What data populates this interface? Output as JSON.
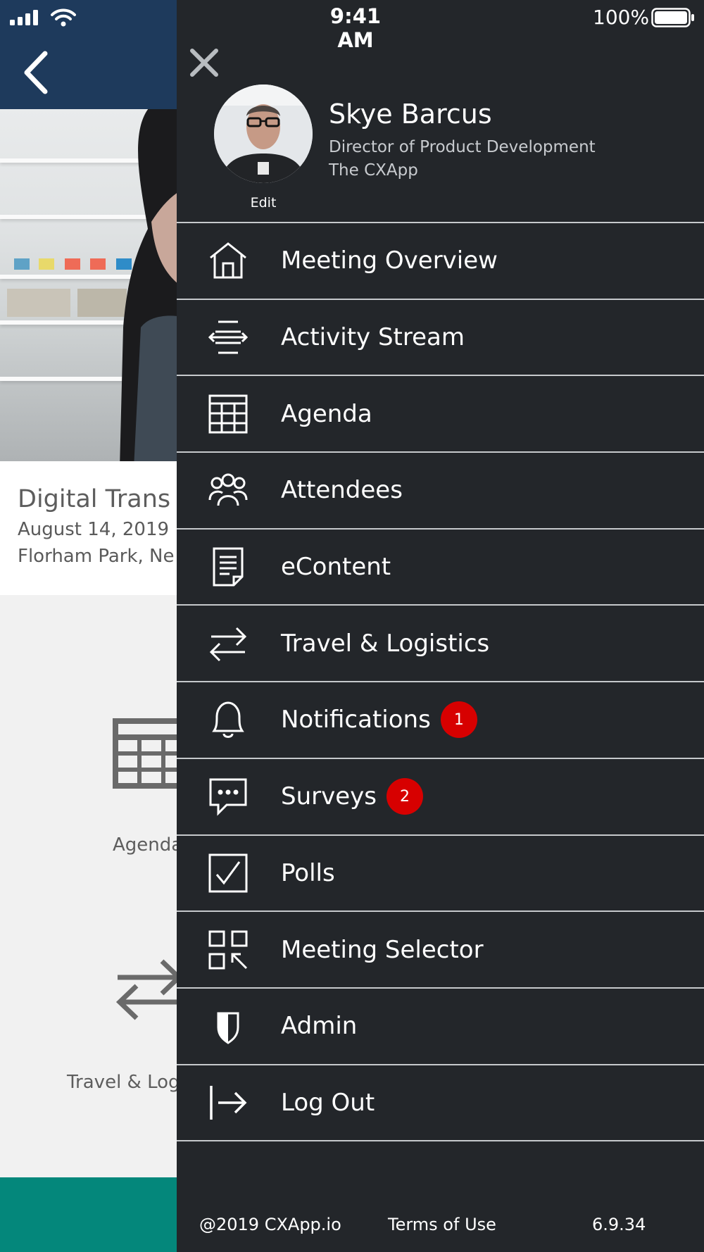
{
  "status_bar": {
    "time": "9:41 AM",
    "battery_percent": "100%",
    "signal_icon": "cellular-signal-icon",
    "wifi_icon": "wifi-icon",
    "battery_icon": "battery-full-icon"
  },
  "background_page": {
    "back_icon": "chevron-left-icon",
    "event": {
      "title": "Digital Trans",
      "date": "August 14, 2019",
      "location": "Florham Park, Ne"
    },
    "tiles": [
      {
        "label": "Agenda",
        "icon": "grid-table-icon"
      },
      {
        "label": "Travel & Log",
        "icon": "swap-arrows-icon"
      }
    ]
  },
  "drawer": {
    "close_icon": "close-icon",
    "profile": {
      "name": "Skye Barcus",
      "title": "Director of Product Development",
      "company": "The CXApp",
      "edit_label": "Edit"
    },
    "menu": [
      {
        "label": "Meeting Overview",
        "icon": "home-icon"
      },
      {
        "label": "Activity Stream",
        "icon": "activity-stream-icon"
      },
      {
        "label": "Agenda",
        "icon": "agenda-grid-icon"
      },
      {
        "label": "Attendees",
        "icon": "attendees-icon"
      },
      {
        "label": "eContent",
        "icon": "document-icon"
      },
      {
        "label": "Travel & Logistics",
        "icon": "swap-arrows-icon"
      },
      {
        "label": "Notifications",
        "icon": "bell-icon",
        "badge": "1"
      },
      {
        "label": "Surveys",
        "icon": "chat-bubble-icon",
        "badge": "2"
      },
      {
        "label": "Polls",
        "icon": "checkbox-icon"
      },
      {
        "label": "Meeting Selector",
        "icon": "qr-selector-icon"
      },
      {
        "label": "Admin",
        "icon": "shield-icon"
      },
      {
        "label": "Log Out",
        "icon": "logout-icon"
      }
    ],
    "footer": {
      "copyright": "@2019 CXApp.io",
      "terms": "Terms of Use",
      "version": "6.9.34"
    }
  },
  "colors": {
    "drawer_bg": "#23262a",
    "header_bg": "#1e3a5c",
    "badge_red": "#d70000",
    "bottom_bar_teal": "#04877b"
  }
}
